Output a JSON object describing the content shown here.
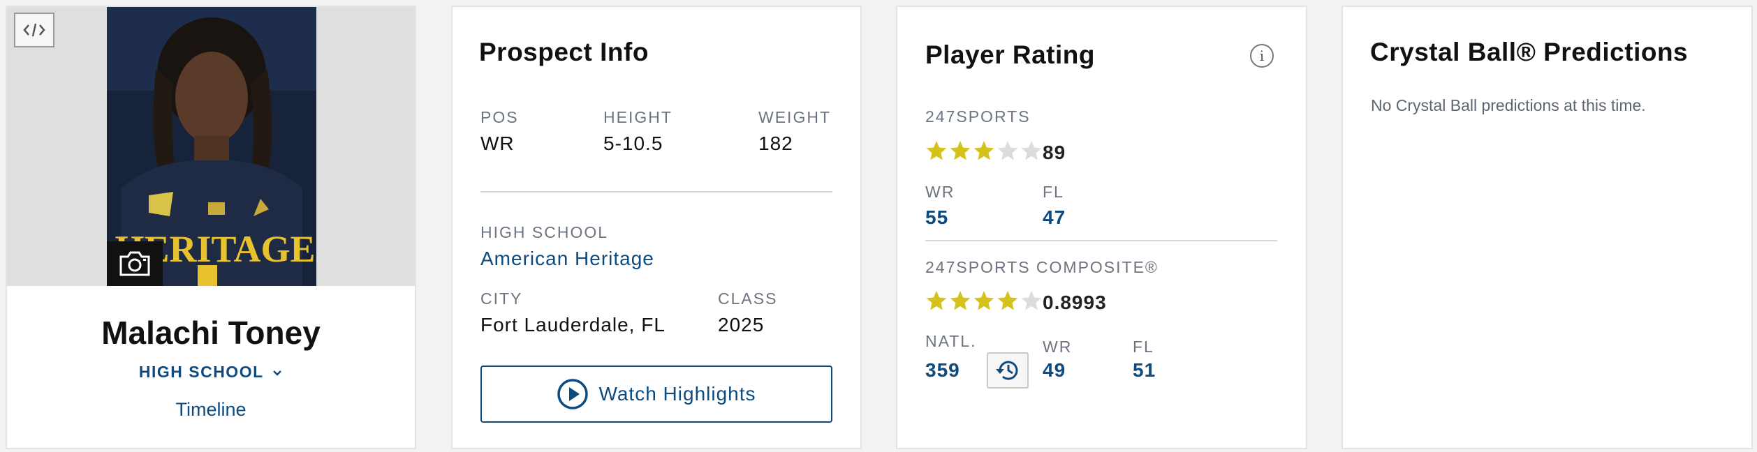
{
  "profile": {
    "name": "Malachi Toney",
    "school_toggle": "HIGH SCHOOL",
    "timeline": "Timeline",
    "jersey_text": "HERITAGE"
  },
  "prospect": {
    "title": "Prospect Info",
    "pos_label": "POS",
    "pos": "WR",
    "height_label": "HEIGHT",
    "height": "5-10.5",
    "weight_label": "WEIGHT",
    "weight": "182",
    "school_label": "HIGH SCHOOL",
    "school": "American Heritage",
    "city_label": "CITY",
    "city": "Fort Lauderdale, FL",
    "class_label": "CLASS",
    "class": "2025",
    "watch_label": "Watch Highlights"
  },
  "rating": {
    "title": "Player Rating",
    "info": "i",
    "sports247": {
      "label": "247SPORTS",
      "stars": 3,
      "score": "89",
      "pos_label": "WR",
      "pos_rank": "55",
      "state_label": "FL",
      "state_rank": "47"
    },
    "composite": {
      "label": "247SPORTS COMPOSITE®",
      "stars": 4,
      "score": "0.8993",
      "natl_label": "NATL.",
      "natl_rank": "359",
      "pos_label": "WR",
      "pos_rank": "49",
      "state_label": "FL",
      "state_rank": "51"
    }
  },
  "crystal": {
    "title": "Crystal Ball® Predictions",
    "empty": "No Crystal Ball predictions at this time."
  },
  "colors": {
    "accent": "#0d4a80",
    "star_on": "#d4c21a",
    "star_off": "#dcdcdc"
  }
}
